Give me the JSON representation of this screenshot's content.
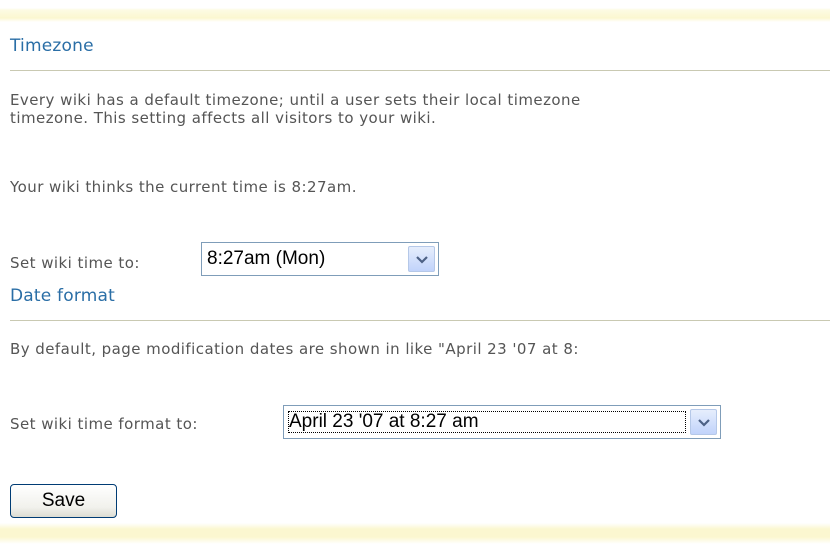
{
  "timezone": {
    "heading": "Timezone",
    "description_line1": "Every wiki has a default timezone; until a user sets their local timezone",
    "description_line2": "timezone. This setting affects all visitors to your wiki.",
    "current_time_text": "Your wiki thinks the current time is 8:27am.",
    "set_label": "Set wiki time to:",
    "selected_time": "8:27am (Mon)",
    "select_icon": "chevron-down-icon"
  },
  "date_format": {
    "heading": "Date format",
    "description": "By default, page modification dates are shown in like \"April 23 '07 at 8:",
    "set_label": "Set wiki time format to:",
    "selected_format": "April 23 '07 at 8:27 am",
    "select_icon": "chevron-down-icon"
  },
  "actions": {
    "save_label": "Save"
  },
  "colors": {
    "heading": "#2a6ea6",
    "body_text": "#555555",
    "band": "#fbf7d0"
  }
}
